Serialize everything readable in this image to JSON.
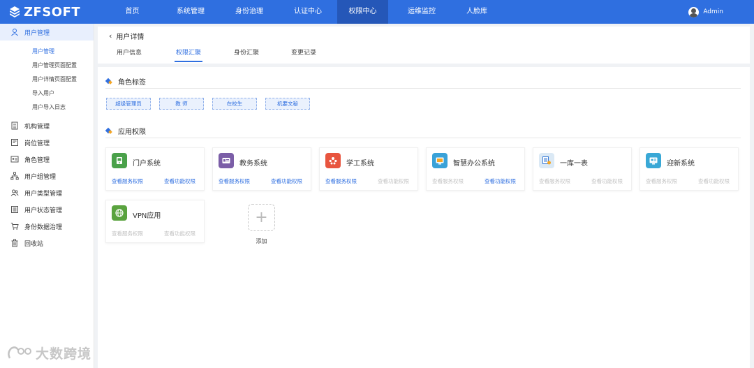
{
  "brand": {
    "name": "ZFSOFT"
  },
  "topnav": {
    "items": [
      {
        "label": "首页"
      },
      {
        "label": "系统管理"
      },
      {
        "label": "身份治理"
      },
      {
        "label": "认证中心"
      },
      {
        "label": "权限中心",
        "active": true
      },
      {
        "label": "运维监控"
      },
      {
        "label": "人脸库"
      }
    ]
  },
  "user": {
    "name": "Admin"
  },
  "sidebar": {
    "group": {
      "label": "用户管理",
      "icon": "user-icon",
      "items": [
        {
          "label": "用户管理",
          "active": true
        },
        {
          "label": "用户管理页面配置"
        },
        {
          "label": "用户详情页面配置"
        },
        {
          "label": "导入用户"
        },
        {
          "label": "用户导入日志"
        }
      ]
    },
    "items": [
      {
        "label": "机构管理",
        "icon": "building-icon"
      },
      {
        "label": "岗位管理",
        "icon": "post-icon"
      },
      {
        "label": "角色管理",
        "icon": "role-card-icon"
      },
      {
        "label": "用户组管理",
        "icon": "org-tree-icon"
      },
      {
        "label": "用户类型管理",
        "icon": "users-icon"
      },
      {
        "label": "用户状态管理",
        "icon": "status-icon"
      },
      {
        "label": "身份数据治理",
        "icon": "cart-icon"
      },
      {
        "label": "回收站",
        "icon": "trash-icon"
      }
    ]
  },
  "page": {
    "back_title": "用户详情",
    "tabs": [
      {
        "label": "用户信息"
      },
      {
        "label": "权限汇聚",
        "active": true
      },
      {
        "label": "身份汇聚"
      },
      {
        "label": "变更记录"
      }
    ]
  },
  "roles": {
    "title": "角色标签",
    "tags": [
      "超级管理员",
      "教 师",
      "在校生",
      "机要文秘"
    ]
  },
  "apps": {
    "title": "应用权限",
    "service_label": "查看服务权限",
    "function_label": "查看功能权限",
    "items": [
      {
        "name": "门户系统",
        "icon": "portal-icon",
        "color": "#4aa14a",
        "service_enabled": true,
        "function_enabled": true
      },
      {
        "name": "教务系统",
        "icon": "academic-icon",
        "color": "#7b5ea7",
        "service_enabled": true,
        "function_enabled": true
      },
      {
        "name": "学工系统",
        "icon": "students-icon",
        "color": "#e8553f",
        "service_enabled": true,
        "function_enabled": false
      },
      {
        "name": "智慧办公系统",
        "icon": "office-icon",
        "color": "#3aa2d8",
        "service_enabled": false,
        "function_enabled": true
      },
      {
        "name": "一库一表",
        "icon": "table-icon",
        "color": "#dbe9f5",
        "service_enabled": false,
        "function_enabled": false
      },
      {
        "name": "迎新系统",
        "icon": "welcome-icon",
        "color": "#39a8d6",
        "service_enabled": false,
        "function_enabled": false
      },
      {
        "name": "VPN应用",
        "icon": "vpn-globe-icon",
        "color": "#5aa33f",
        "service_enabled": false,
        "function_enabled": false
      }
    ],
    "add_label": "添加"
  },
  "watermark": {
    "text": "大数跨境"
  }
}
